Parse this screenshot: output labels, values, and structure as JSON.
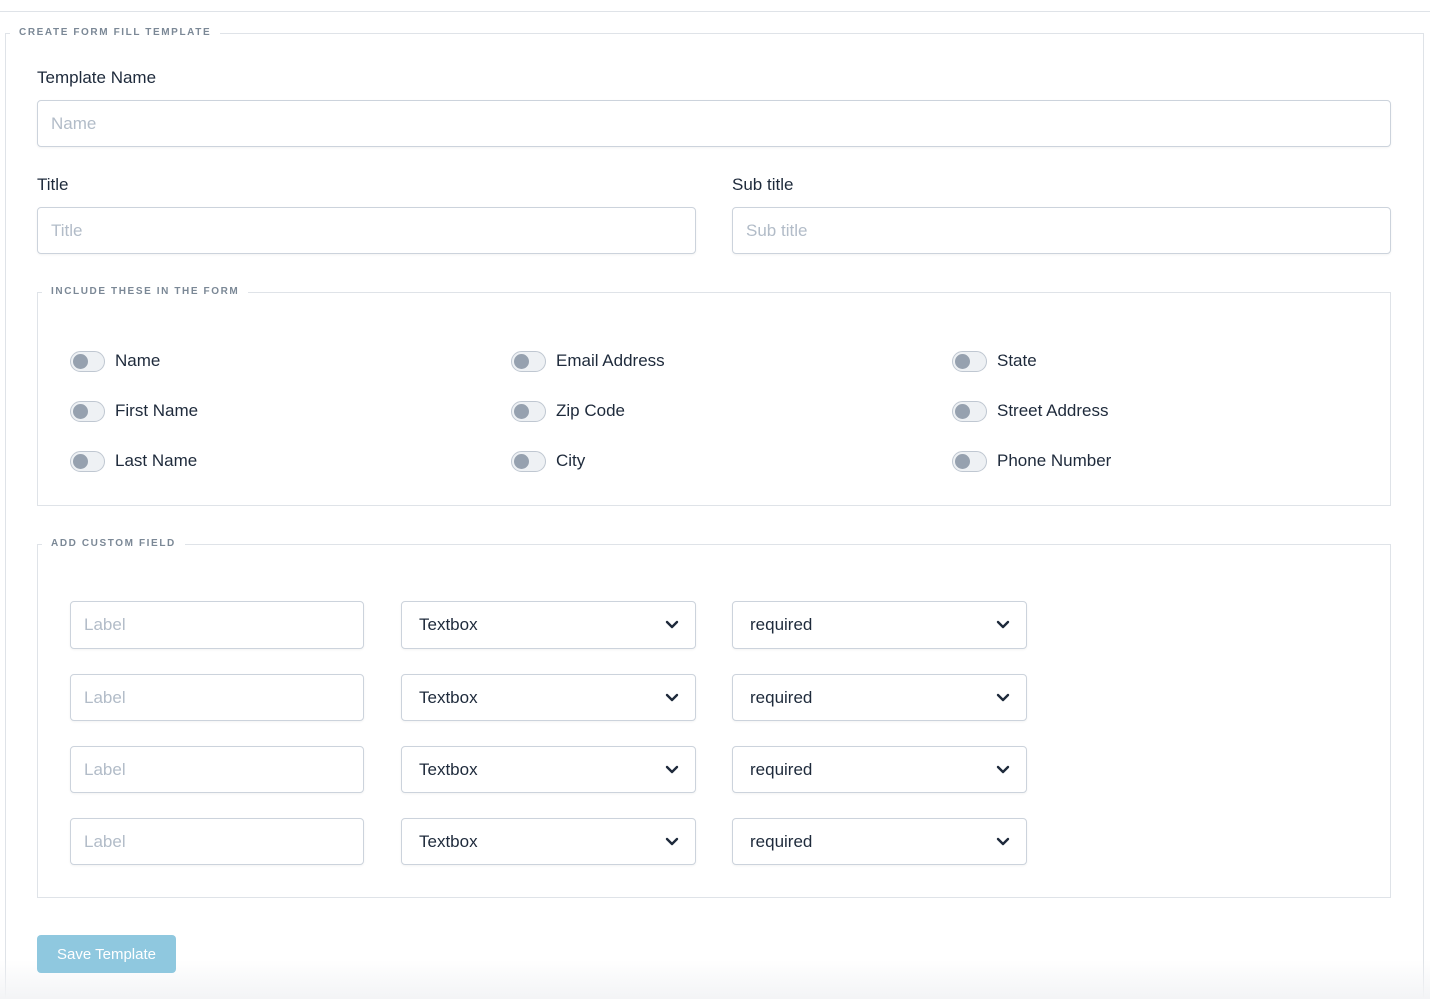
{
  "form": {
    "legend": "CREATE FORM FILL TEMPLATE",
    "template_name_label": "Template Name",
    "template_name_placeholder": "Name",
    "title_label": "Title",
    "title_placeholder": "Title",
    "subtitle_label": "Sub title",
    "subtitle_placeholder": "Sub title"
  },
  "include": {
    "legend": "INCLUDE THESE IN THE FORM",
    "toggles": [
      {
        "label": "Name",
        "on": false
      },
      {
        "label": "Email Address",
        "on": false
      },
      {
        "label": "State",
        "on": false
      },
      {
        "label": "First Name",
        "on": false
      },
      {
        "label": "Zip Code",
        "on": false
      },
      {
        "label": "Street Address",
        "on": false
      },
      {
        "label": "Last Name",
        "on": false
      },
      {
        "label": "City",
        "on": false
      },
      {
        "label": "Phone Number",
        "on": false
      }
    ]
  },
  "custom": {
    "legend": "ADD CUSTOM FIELD",
    "rows": [
      {
        "label_placeholder": "Label",
        "type": "Textbox",
        "requirement": "required"
      },
      {
        "label_placeholder": "Label",
        "type": "Textbox",
        "requirement": "required"
      },
      {
        "label_placeholder": "Label",
        "type": "Textbox",
        "requirement": "required"
      },
      {
        "label_placeholder": "Label",
        "type": "Textbox",
        "requirement": "required"
      }
    ]
  },
  "actions": {
    "save_label": "Save Template"
  },
  "colors": {
    "save_button": "#8fc8df",
    "toggle_knob": "#96a1af",
    "border": "#ccd3dc"
  }
}
